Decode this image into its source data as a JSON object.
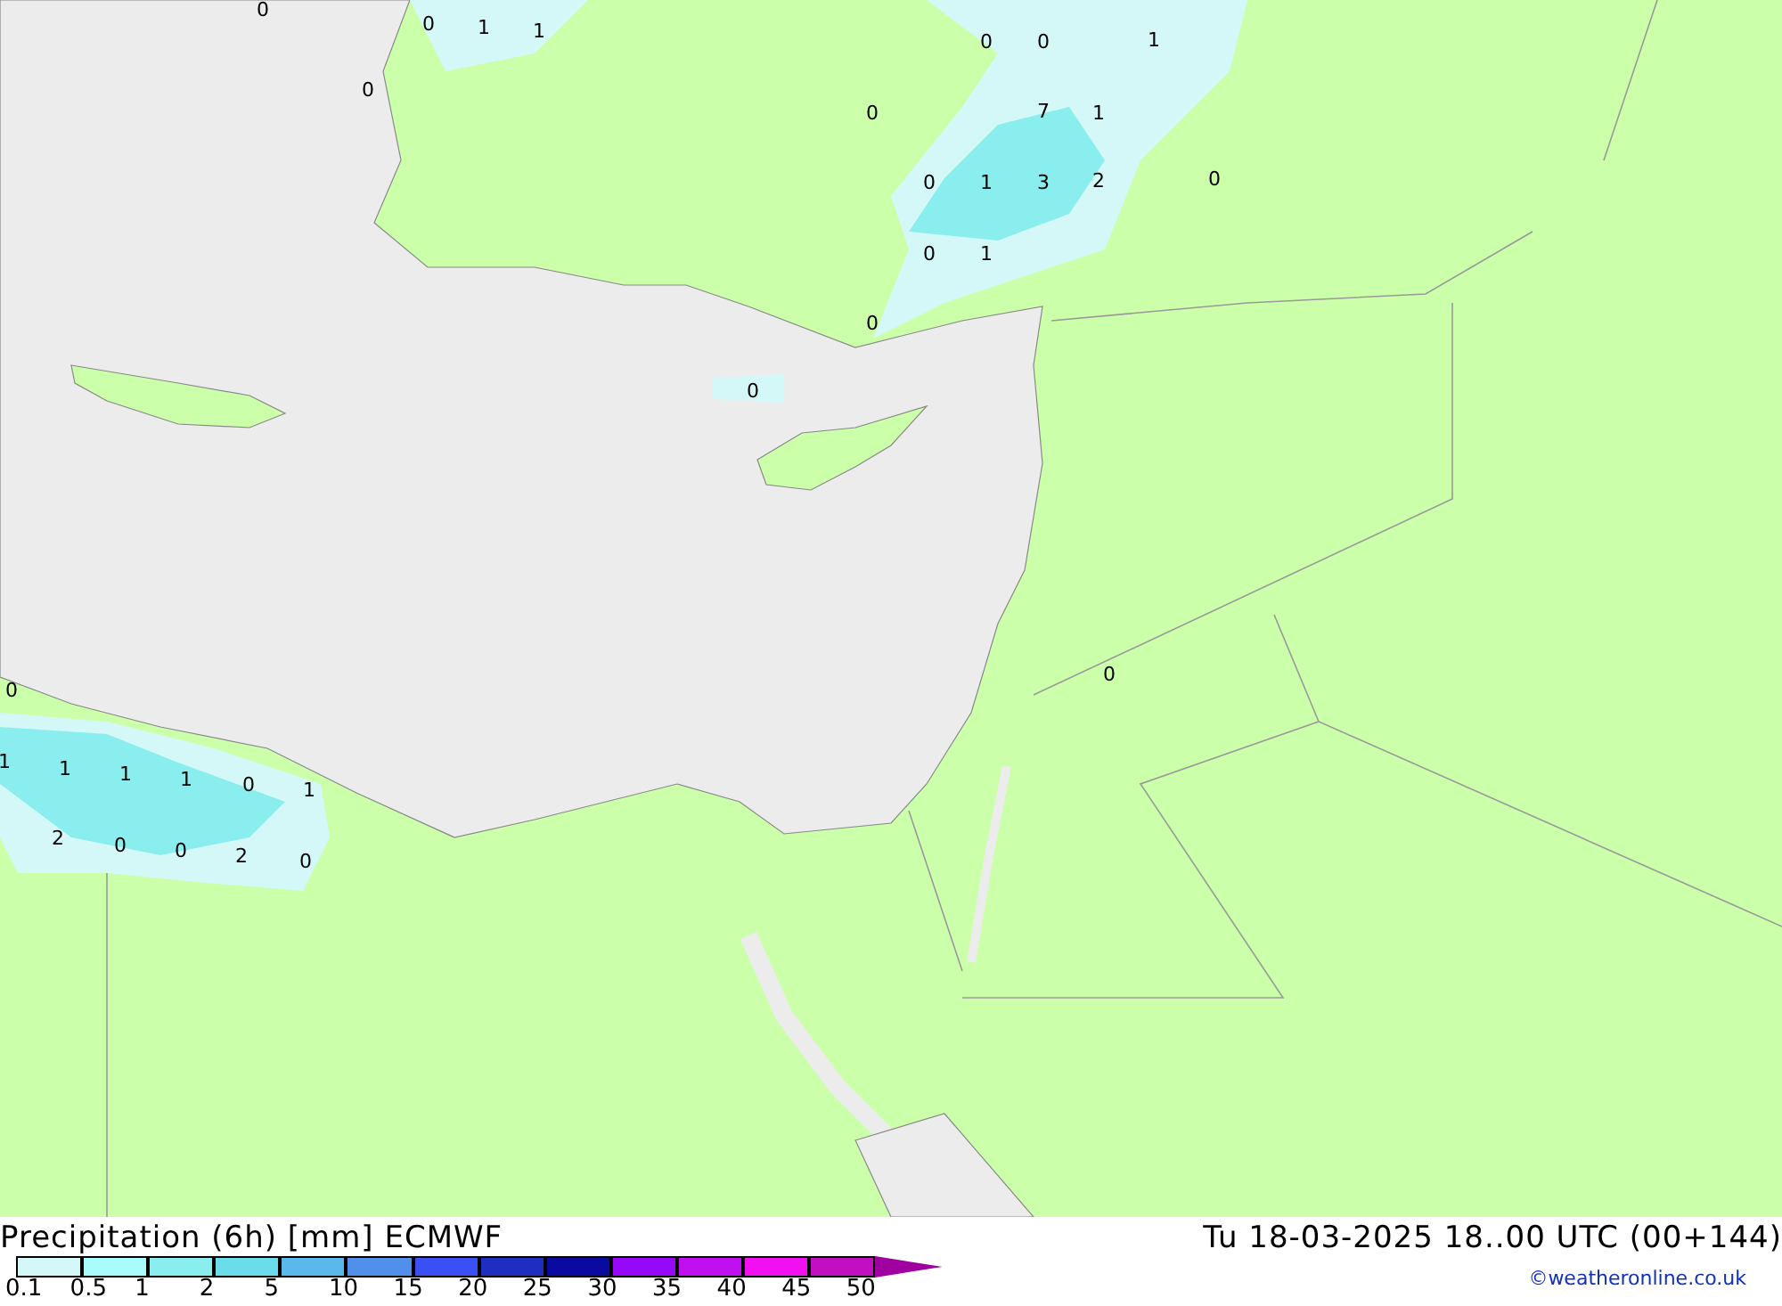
{
  "map": {
    "values": [
      "0",
      "0",
      "1",
      "1",
      "0",
      "0",
      "0",
      "1",
      "0",
      "7",
      "1",
      "0",
      "1",
      "3",
      "2",
      "0",
      "0",
      "1",
      "0",
      "0",
      "0",
      "0",
      "1",
      "1",
      "1",
      "1",
      "0",
      "1",
      "2",
      "0",
      "0",
      "2",
      "0"
    ]
  },
  "footer": {
    "title": "Precipitation (6h) [mm] ECMWF",
    "datetime": "Tu 18-03-2025 18..00 UTC (00+144)",
    "credit": "©weatheronline.co.uk"
  },
  "legend": {
    "bins": [
      {
        "color": "#d4f8f8"
      },
      {
        "color": "#a8fcfc"
      },
      {
        "color": "#8aeeee"
      },
      {
        "color": "#6adcea"
      },
      {
        "color": "#5ab8ea"
      },
      {
        "color": "#5090ea"
      },
      {
        "color": "#3a50f5"
      },
      {
        "color": "#1e2ec0"
      },
      {
        "color": "#0a0aa0"
      },
      {
        "color": "#9608f8"
      },
      {
        "color": "#c010f0"
      },
      {
        "color": "#f010f0"
      },
      {
        "color": "#c010c0"
      }
    ],
    "ticks": [
      "0.1",
      "0.5",
      "1",
      "2",
      "5",
      "10",
      "15",
      "20",
      "25",
      "30",
      "35",
      "40",
      "45",
      "50"
    ]
  }
}
